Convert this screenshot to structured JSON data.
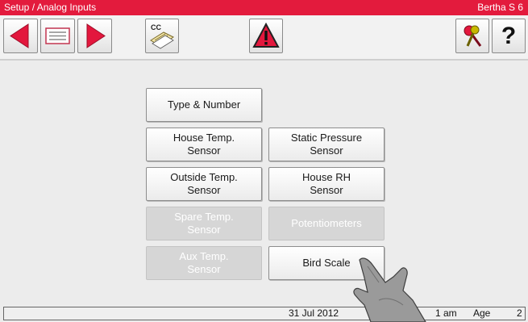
{
  "title": {
    "left": "Setup / Analog Inputs",
    "right": "Bertha S 6"
  },
  "colors": {
    "title_bg": "#e31b3d",
    "arrow": "#e3173d",
    "warning": "#e3173d"
  },
  "toolbar": {
    "back_icon": "left-arrow-icon",
    "list_icon": "list-form-icon",
    "forward_icon": "right-arrow-icon",
    "cc_label": "CC",
    "cc_icon": "copy-config-icon",
    "warning_icon": "warning-triangle-icon",
    "key_icon": "keys-icon",
    "help_label": "?"
  },
  "menu": {
    "type_number": "Type & Number",
    "house_temp": "House Temp.\nSensor",
    "static_pressure": "Static Pressure\nSensor",
    "outside_temp": "Outside Temp.\nSensor",
    "house_rh": "House RH\nSensor",
    "spare_temp": "Spare Temp.\nSensor",
    "potentiometers": "Potentiometers",
    "aux_temp": "Aux Temp.\nSensor",
    "bird_scale": "Bird Scale"
  },
  "status": {
    "date": "31 Jul 2012",
    "time_fragment": "1 am",
    "age_label": "Age",
    "age_value": "2"
  }
}
